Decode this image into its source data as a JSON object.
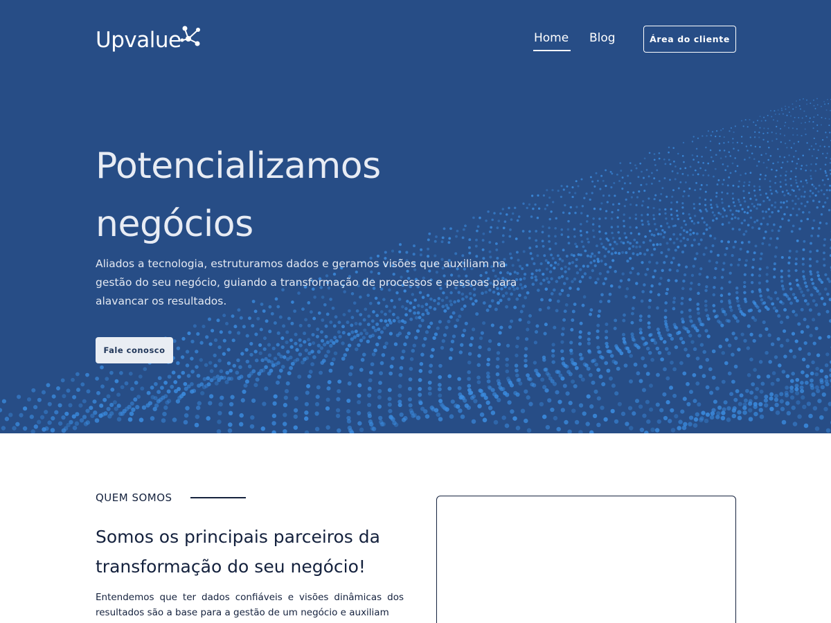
{
  "brand": {
    "logo_text": "Upvalue"
  },
  "nav": {
    "items": [
      {
        "label": "Home",
        "active": true
      },
      {
        "label": "Blog",
        "active": false
      }
    ],
    "client_button": "Área do cliente"
  },
  "hero": {
    "title_line1": "Potencializamos",
    "title_line2": "negócios",
    "description": "Aliados a tecnologia, estruturamos dados e geramos visões que auxiliam na gestão do seu negócio, guiando a transformação de processos e pessoas para alavancar os resultados.",
    "cta": "Fale conosco"
  },
  "about": {
    "label": "QUEM SOMOS",
    "title": "Somos os principais parceiros da transformação do seu negócio!",
    "text": "Entendemos que ter dados confiáveis e visões dinâmicas dos resultados são a base para a gestão de um negócio e auxiliam"
  },
  "colors": {
    "hero_bg": "#274d86",
    "dots": "#3b8ce0",
    "text_dark": "#14213d",
    "white": "#ffffff"
  }
}
